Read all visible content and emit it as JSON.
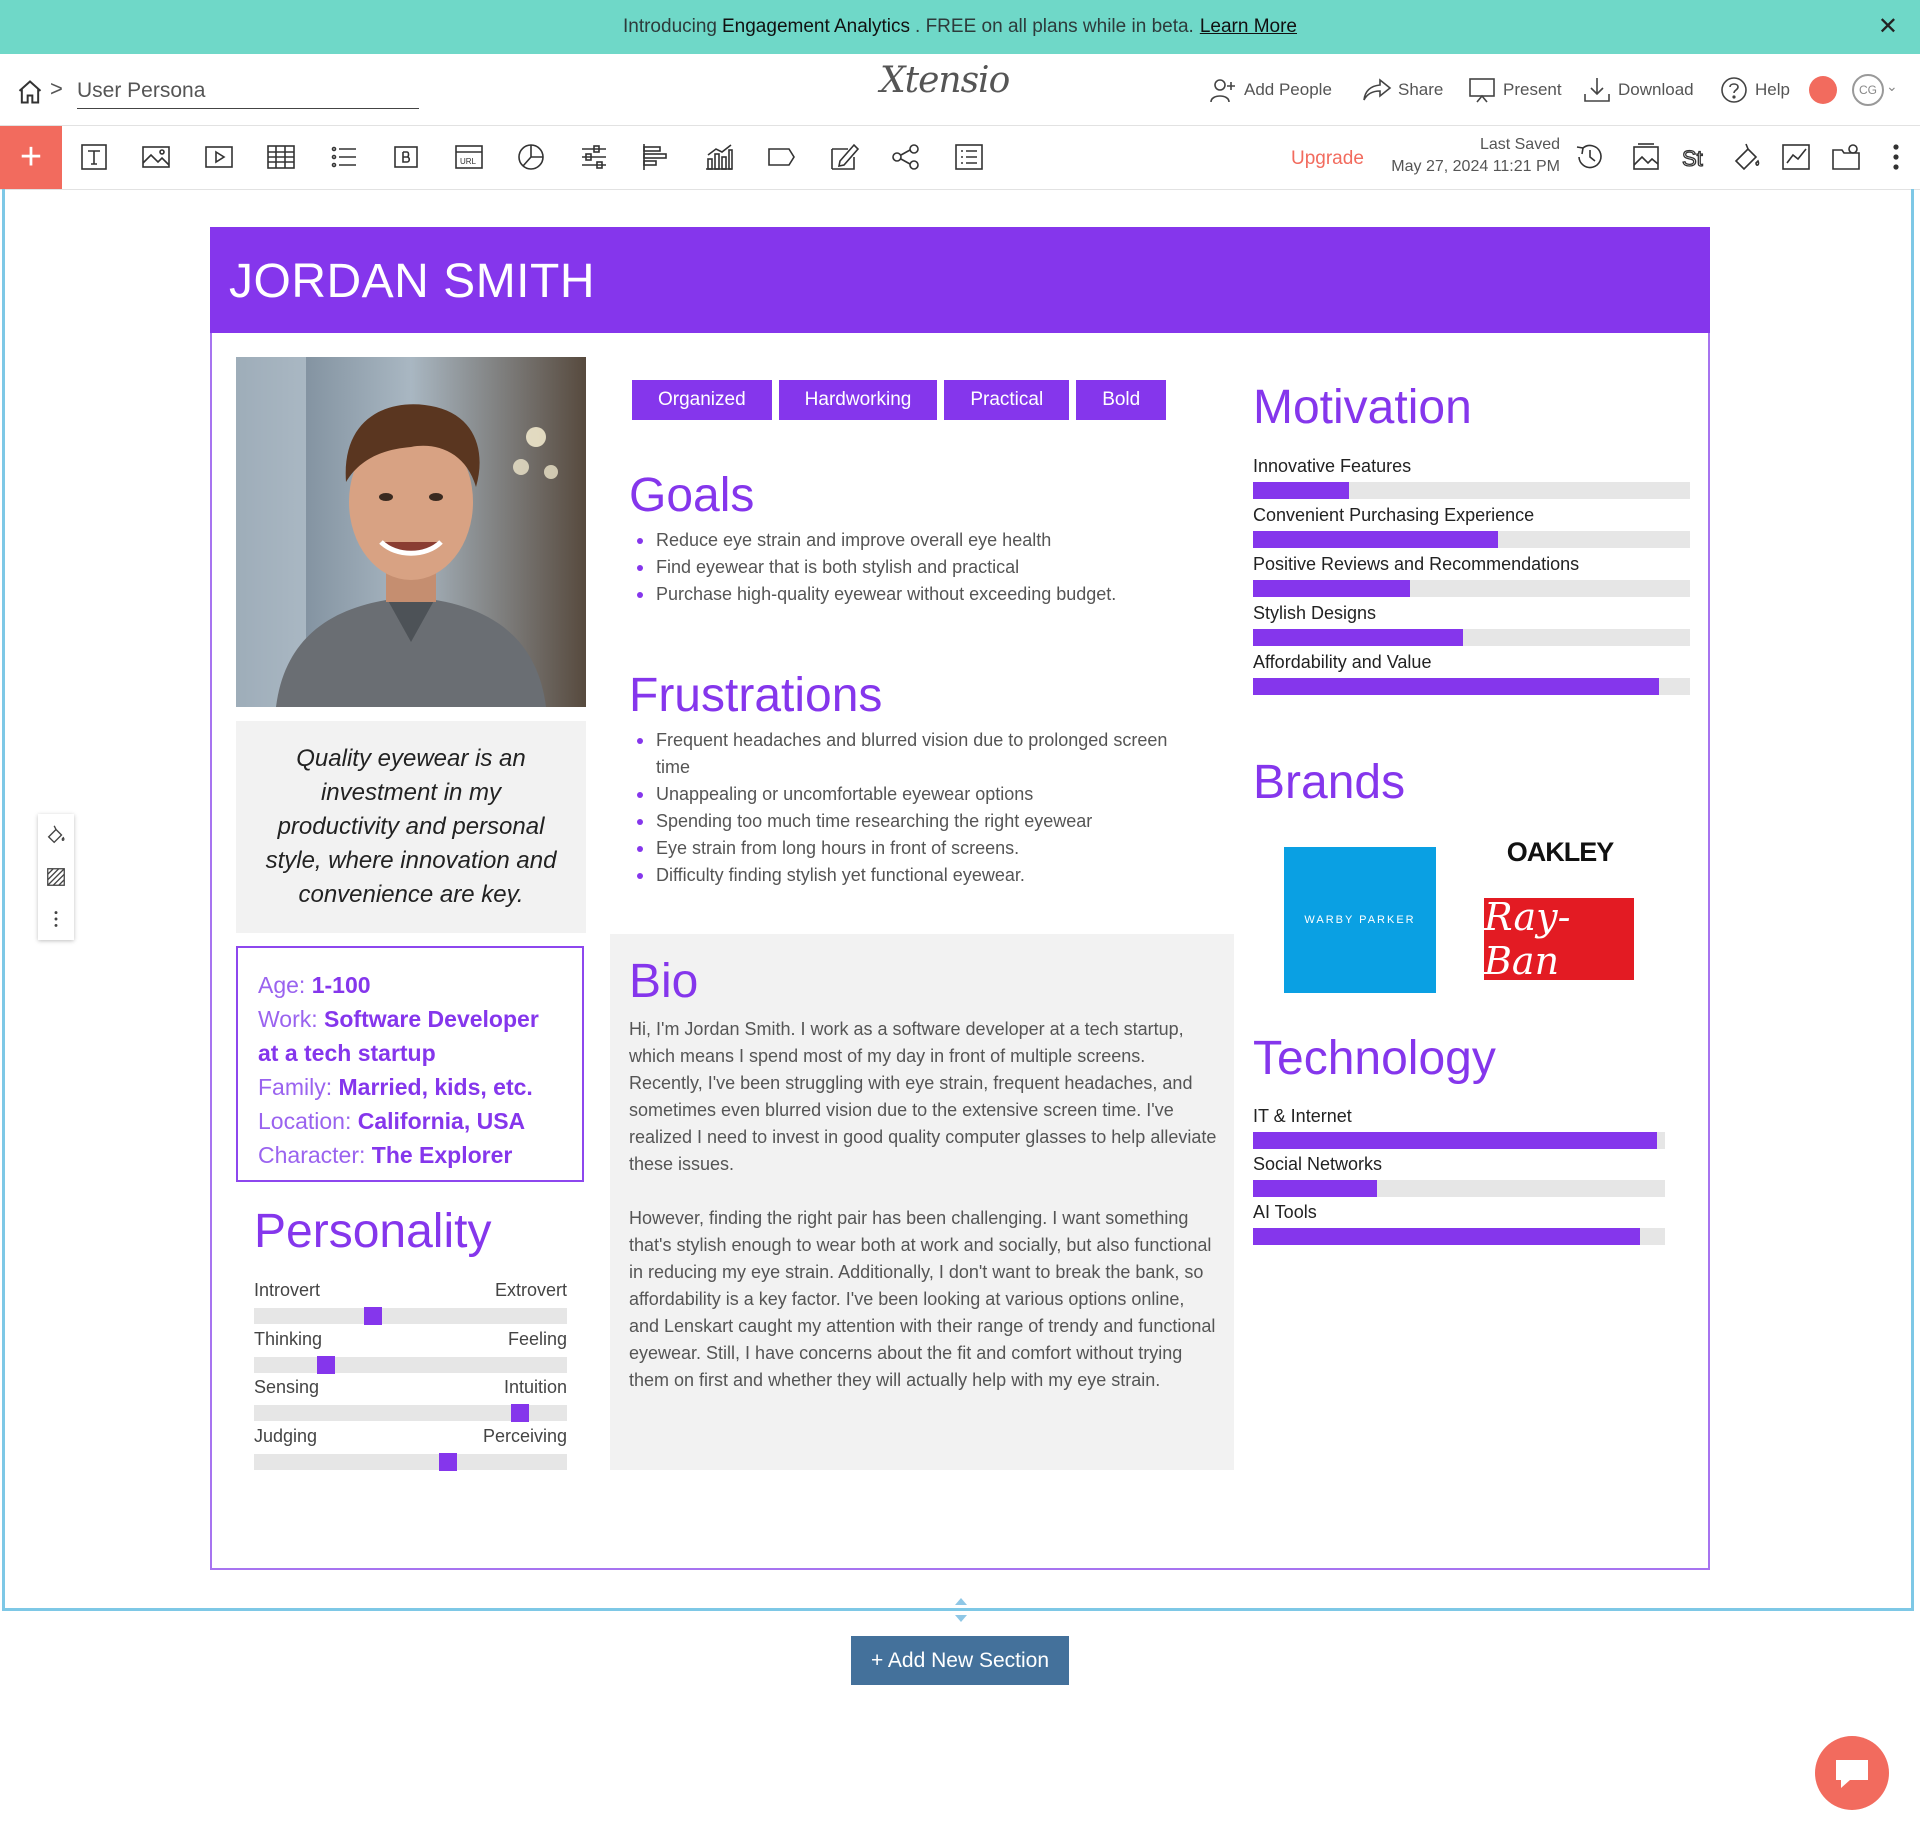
{
  "banner": {
    "pre": "Introducing",
    "highlight": "Engagement Analytics",
    "post": ". FREE on all plans while in beta.",
    "link": "Learn More",
    "close": "✕"
  },
  "nav": {
    "separator": ">",
    "doc_title": "User Persona",
    "logo": "Xtensio",
    "actions": {
      "add_people": "Add People",
      "share": "Share",
      "present": "Present",
      "download": "Download",
      "help": "Help"
    },
    "avatar": "CG"
  },
  "toolbar": {
    "add": "+",
    "tools": [
      "text-block-icon",
      "image-icon",
      "video-icon",
      "table-icon",
      "list-icon",
      "button-icon",
      "url-icon",
      "pie-chart-icon",
      "slider-icon",
      "bar-chart-horizontal-icon",
      "bar-chart-icon",
      "tag-icon",
      "form-icon",
      "share-nodes-icon",
      "list-box-icon"
    ],
    "upgrade": "Upgrade",
    "last_saved_label": "Last Saved",
    "last_saved_date": "May 27, 2024 11:21 PM",
    "right_tools": [
      "history-icon",
      "background-image-icon",
      "style-icon",
      "paint-icon",
      "analytics-icon",
      "settings-folder-icon",
      "more-icon"
    ]
  },
  "persona": {
    "name": "JORDAN SMITH",
    "quote": "Quality eyewear is an investment in my productivity and personal style, where innovation and convenience are key.",
    "info": [
      {
        "label": "Age:",
        "value": "1-100"
      },
      {
        "label": "Work:",
        "value": "Software Developer at a tech startup"
      },
      {
        "label": "Family:",
        "value": "Married, kids, etc."
      },
      {
        "label": "Location:",
        "value": "California, USA"
      },
      {
        "label": "Character:",
        "value": "The Explorer"
      }
    ],
    "personality": {
      "title": "Personality",
      "scales": [
        {
          "left": "Introvert",
          "right": "Extrovert",
          "position": 0.38
        },
        {
          "left": "Thinking",
          "right": "Feeling",
          "position": 0.23
        },
        {
          "left": "Sensing",
          "right": "Intuition",
          "position": 0.85
        },
        {
          "left": "Judging",
          "right": "Perceiving",
          "position": 0.62
        }
      ]
    },
    "tags": [
      "Organized",
      "Hardworking",
      "Practical",
      "Bold"
    ],
    "goals": {
      "title": "Goals",
      "items": [
        "Reduce eye strain and improve overall eye health",
        "Find eyewear that is both stylish and practical",
        "Purchase high-quality eyewear without exceeding budget."
      ]
    },
    "frustrations": {
      "title": "Frustrations",
      "items": [
        "Frequent headaches and blurred vision due to prolonged screen time",
        "Unappealing or uncomfortable eyewear options",
        "Spending too much time researching the right eyewear",
        "Eye strain from long hours in front of screens.",
        "Difficulty finding stylish yet functional eyewear."
      ]
    },
    "bio": {
      "title": "Bio",
      "paragraphs": [
        "Hi, I'm Jordan Smith. I work as a software developer at a tech startup, which means I spend most of my day in front of multiple screens. Recently, I've been struggling with eye strain, frequent headaches, and sometimes even blurred vision due to the extensive screen time. I've realized I need to invest in good quality computer glasses to help alleviate these issues.",
        "However, finding the right pair has been challenging. I want something that's stylish enough to wear both at work and socially, but also functional in reducing my eye strain. Additionally, I don't want to break the bank, so affordability is a key factor. I've been looking at various options online, and Lenskart caught my attention with their range of trendy and functional eyewear. Still, I have concerns about the fit and comfort without trying them on first and whether they will actually help with my eye strain."
      ]
    },
    "motivation": {
      "title": "Motivation",
      "items": [
        {
          "label": "Innovative Features",
          "value": 0.22
        },
        {
          "label": "Convenient Purchasing Experience",
          "value": 0.56
        },
        {
          "label": "Positive Reviews and Recommendations",
          "value": 0.36
        },
        {
          "label": "Stylish Designs",
          "value": 0.48
        },
        {
          "label": "Affordability and Value",
          "value": 0.93
        }
      ]
    },
    "brands": {
      "title": "Brands",
      "logos": [
        "WARBY PARKER",
        "OAKLEY",
        "Ray-Ban"
      ]
    },
    "technology": {
      "title": "Technology",
      "items": [
        {
          "label": "IT & Internet",
          "value": 0.98
        },
        {
          "label": "Social Networks",
          "value": 0.3
        },
        {
          "label": "AI Tools",
          "value": 0.94
        }
      ]
    }
  },
  "bottom": {
    "add_section": "+ Add New Section"
  },
  "colors": {
    "accent": "#8536ec",
    "banner": "#6fd8c8",
    "coral": "#f26b5e",
    "button_blue": "#44719b",
    "frame": "#7ec8e6"
  }
}
